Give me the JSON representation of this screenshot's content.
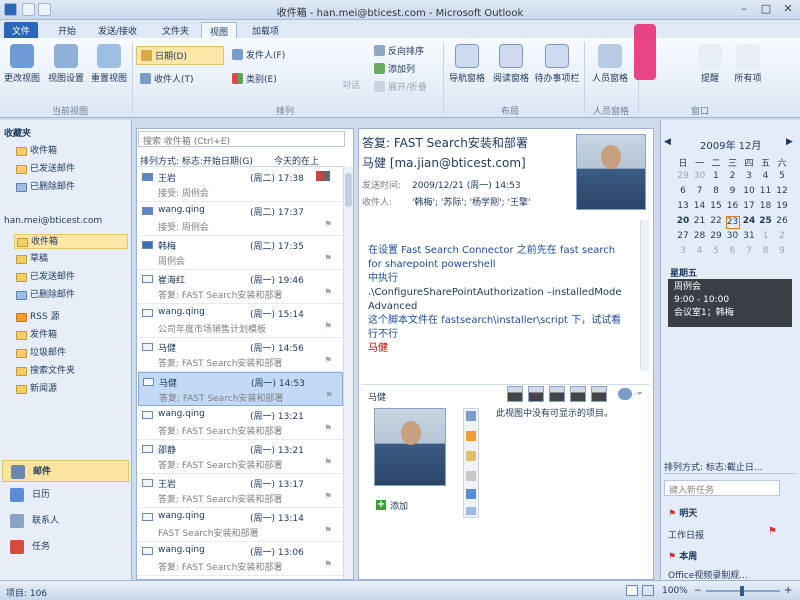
{
  "window": {
    "title": "收件箱 - han.mei@bticest.com - Microsoft Outlook"
  },
  "tabs": [
    "文件",
    "开始",
    "发送/接收",
    "文件夹",
    "视图",
    "加载项"
  ],
  "ribbon": {
    "groups": {
      "current_view": {
        "label": "当前视图",
        "buttons": [
          "更改视图",
          "视图设置",
          "重置视图"
        ]
      },
      "arrangement": {
        "label": "排列",
        "items": [
          "日期(D)",
          "收件人(T)",
          "发件人(F)",
          "类别(E)",
          "反向排序",
          "添加列",
          "展开/折叠"
        ]
      },
      "layout": {
        "label": "布局",
        "buttons": [
          "导航窗格",
          "阅读窗格",
          "待办事项栏"
        ]
      },
      "people": {
        "label": "人员窗格",
        "buttons": [
          "人员窗格"
        ]
      },
      "window": {
        "label": "窗口",
        "buttons": [
          "提醒",
          "所有项"
        ]
      }
    }
  },
  "nav": {
    "favorites": {
      "title": "收藏夹",
      "items": [
        "收件箱",
        "已发送邮件",
        "已删除邮件"
      ]
    },
    "account": {
      "title": "han.mei@bticest.com",
      "items": [
        "收件箱",
        "草稿",
        "已发送邮件",
        "已删除邮件",
        "RSS 源",
        "发件箱",
        "垃圾邮件",
        "搜索文件夹",
        "新闻源"
      ]
    },
    "modules": [
      "邮件",
      "日历",
      "联系人",
      "任务"
    ]
  },
  "list": {
    "search_placeholder": "搜索 收件箱 (Ctrl+E)",
    "sort_label": "排列方式: 标志:开始日期(G)",
    "sort_right": "今天的在上",
    "items": [
      {
        "sender": "王岩",
        "date": "(周二) 17:38",
        "subject": "接受: 周例会"
      },
      {
        "sender": "wang.qing",
        "date": "(周二) 17:37",
        "subject": "接受: 周例会"
      },
      {
        "sender": "韩梅",
        "date": "(周二) 17:35",
        "subject": "周例会"
      },
      {
        "sender": "崔海红",
        "date": "(周一) 19:46",
        "subject": "答复: FAST Search安装和部署"
      },
      {
        "sender": "wang.qing",
        "date": "(周一) 15:14",
        "subject": "公司年度市场销售计划模板"
      },
      {
        "sender": "马健",
        "date": "(周一) 14:56",
        "subject": "答复: FAST Search安装和部署"
      },
      {
        "sender": "马健",
        "date": "(周一) 14:53",
        "subject": "答复: FAST Search安装和部署"
      },
      {
        "sender": "wang.qing",
        "date": "(周一) 13:21",
        "subject": "答复: FAST Search安装和部署"
      },
      {
        "sender": "邵静",
        "date": "(周一) 13:21",
        "subject": "答复: FAST Search安装和部署"
      },
      {
        "sender": "王岩",
        "date": "(周一) 13:17",
        "subject": "答复: FAST Search安装和部署"
      },
      {
        "sender": "wang.qing",
        "date": "(周一) 13:14",
        "subject": "FAST Search安装和部署"
      },
      {
        "sender": "wang.qing",
        "date": "(周一) 13:06",
        "subject": "答复: FAST Search安装和部署"
      }
    ]
  },
  "reading": {
    "subject": "答复: FAST Search安装和部署",
    "from": "马健 [ma.jian@bticest.com]",
    "sent_label": "发送时间:",
    "sent_value": "2009/12/21 (周一) 14:53",
    "to_label": "收件人:",
    "to_value": "'韩梅'; '苏际'; '杨学刚'; '王擎'",
    "body": [
      "在设置 Fast Search Connector 之前先在  fast search for sharepoint powershell",
      "中执行",
      ".\\ConfigureSharePointAuthorization –installedMode Advanced",
      "这个脚本文件在 fastsearch\\installer\\script 下，试试看行不行",
      "马健"
    ],
    "people_name": "马健",
    "people_empty": "此视图中没有可显示的项目。",
    "people_add": "添加"
  },
  "todo": {
    "month": "2009年 12月",
    "weekdays": [
      "日",
      "一",
      "二",
      "三",
      "四",
      "五",
      "六"
    ],
    "weeks": [
      [
        "29",
        "30",
        "1",
        "2",
        "3",
        "4",
        "5"
      ],
      [
        "6",
        "7",
        "8",
        "9",
        "10",
        "11",
        "12"
      ],
      [
        "13",
        "14",
        "15",
        "16",
        "17",
        "18",
        "19"
      ],
      [
        "20",
        "21",
        "22",
        "23",
        "24",
        "25",
        "26"
      ],
      [
        "27",
        "28",
        "29",
        "30",
        "31",
        "1",
        "2"
      ],
      [
        "3",
        "4",
        "5",
        "6",
        "7",
        "8",
        "9"
      ]
    ],
    "today_label": "星期五",
    "appointment": {
      "title": "周例会",
      "time": "9:00 - 10:00",
      "location": "会议室1；韩梅"
    },
    "sort_label": "排列方式: 标志:截止日...",
    "new_task": "键入新任务",
    "groups": [
      "明天",
      "本周"
    ],
    "tasks": [
      "工作日报",
      "Office视频录制规..."
    ]
  },
  "status": {
    "items": "项目: 106",
    "zoom": "100%"
  }
}
